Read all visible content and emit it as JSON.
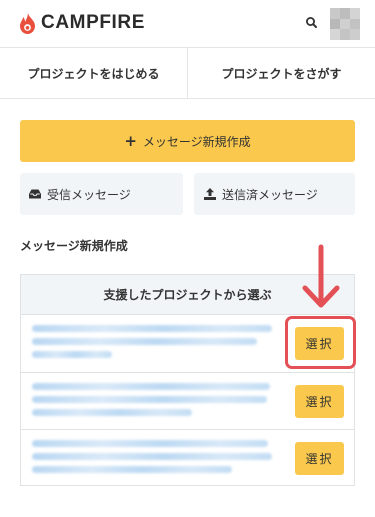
{
  "header": {
    "brand": "CAMPFIRE",
    "brand_color": "#e84f3d",
    "search_icon": "search-icon",
    "avatar": "user-avatar"
  },
  "nav": {
    "start_project": "プロジェクトをはじめる",
    "find_project": "プロジェクトをさがす"
  },
  "actions": {
    "new_message": "メッセージ新規作成",
    "inbox": "受信メッセージ",
    "sent": "送信済メッセージ"
  },
  "section": {
    "title": "メッセージ新規作成"
  },
  "panel": {
    "header": "支援したプロジェクトから選ぶ",
    "rows": [
      {
        "select_label": "選択"
      },
      {
        "select_label": "選択"
      },
      {
        "select_label": "選択"
      }
    ]
  },
  "colors": {
    "accent_yellow": "#f9c84c",
    "highlight_red": "#e35055",
    "panel_bg": "#f1f5f8"
  }
}
